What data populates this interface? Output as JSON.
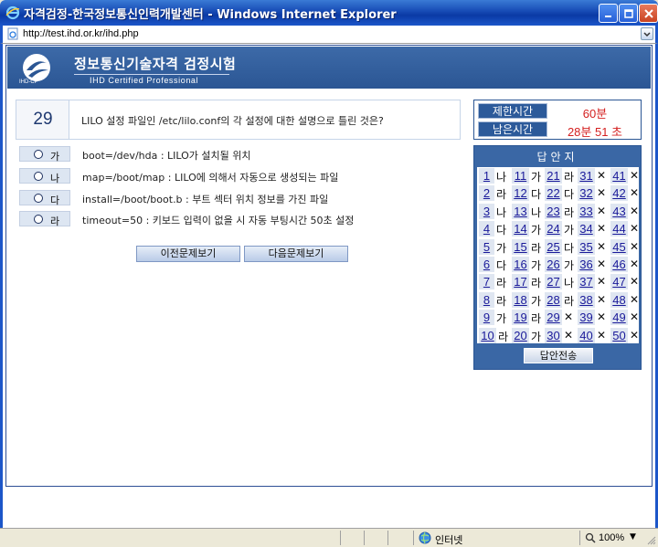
{
  "window": {
    "title": "자격검정-한국정보통신인력개발센터 - Windows Internet Explorer",
    "url": "http://test.ihd.or.kr/ihd.php"
  },
  "banner": {
    "logo_text": "IHD-CP",
    "title": "정보통신기술자격 검정시험",
    "subtitle": "IHD Certified Professional"
  },
  "question": {
    "number": "29",
    "text": "LILO 설정 파일인 /etc/lilo.conf의 각 설정에 대한 설명으로 틀린 것은?",
    "options": [
      {
        "letter": "가",
        "text": "boot=/dev/hda : LILO가 설치될 위치"
      },
      {
        "letter": "나",
        "text": "map=/boot/map : LILO에 의해서 자동으로 생성되는 파일"
      },
      {
        "letter": "다",
        "text": "install=/boot/boot.b : 부트 섹터 위치 정보를 가진 파일"
      },
      {
        "letter": "라",
        "text": "timeout=50 : 키보드 입력이 없을 시 자동 부팅시간 50초 설정"
      }
    ]
  },
  "nav": {
    "prev_label": "이전문제보기",
    "next_label": "다음문제보기"
  },
  "timer": {
    "limit_label": "제한시간",
    "limit_value": "60분",
    "remain_label": "남은시간",
    "remain_value": "28분 51 초"
  },
  "answer_sheet": {
    "title": "답안지",
    "submit_label": "답안전송",
    "columns": [
      [
        [
          "1",
          "나"
        ],
        [
          "2",
          "라"
        ],
        [
          "3",
          "나"
        ],
        [
          "4",
          "다"
        ],
        [
          "5",
          "가"
        ],
        [
          "6",
          "다"
        ],
        [
          "7",
          "라"
        ],
        [
          "8",
          "라"
        ],
        [
          "9",
          "가"
        ],
        [
          "10",
          "라"
        ]
      ],
      [
        [
          "11",
          "가"
        ],
        [
          "12",
          "다"
        ],
        [
          "13",
          "나"
        ],
        [
          "14",
          "가"
        ],
        [
          "15",
          "라"
        ],
        [
          "16",
          "가"
        ],
        [
          "17",
          "라"
        ],
        [
          "18",
          "가"
        ],
        [
          "19",
          "라"
        ],
        [
          "20",
          "가"
        ]
      ],
      [
        [
          "21",
          "라"
        ],
        [
          "22",
          "다"
        ],
        [
          "23",
          "라"
        ],
        [
          "24",
          "가"
        ],
        [
          "25",
          "다"
        ],
        [
          "26",
          "가"
        ],
        [
          "27",
          "나"
        ],
        [
          "28",
          "라"
        ],
        [
          "29",
          "✕"
        ],
        [
          "30",
          "✕"
        ]
      ],
      [
        [
          "31",
          "✕"
        ],
        [
          "32",
          "✕"
        ],
        [
          "33",
          "✕"
        ],
        [
          "34",
          "✕"
        ],
        [
          "35",
          "✕"
        ],
        [
          "36",
          "✕"
        ],
        [
          "37",
          "✕"
        ],
        [
          "38",
          "✕"
        ],
        [
          "39",
          "✕"
        ],
        [
          "40",
          "✕"
        ]
      ],
      [
        [
          "41",
          "✕"
        ],
        [
          "42",
          "✕"
        ],
        [
          "43",
          "✕"
        ],
        [
          "44",
          "✕"
        ],
        [
          "45",
          "✕"
        ],
        [
          "46",
          "✕"
        ],
        [
          "47",
          "✕"
        ],
        [
          "48",
          "✕"
        ],
        [
          "49",
          "✕"
        ],
        [
          "50",
          "✕"
        ]
      ]
    ]
  },
  "status": {
    "zone": "인터넷",
    "zoom": "100%"
  },
  "colors": {
    "banner": "#2b5694",
    "time_value": "#d42020",
    "answer_num": "#1a1a9a"
  }
}
